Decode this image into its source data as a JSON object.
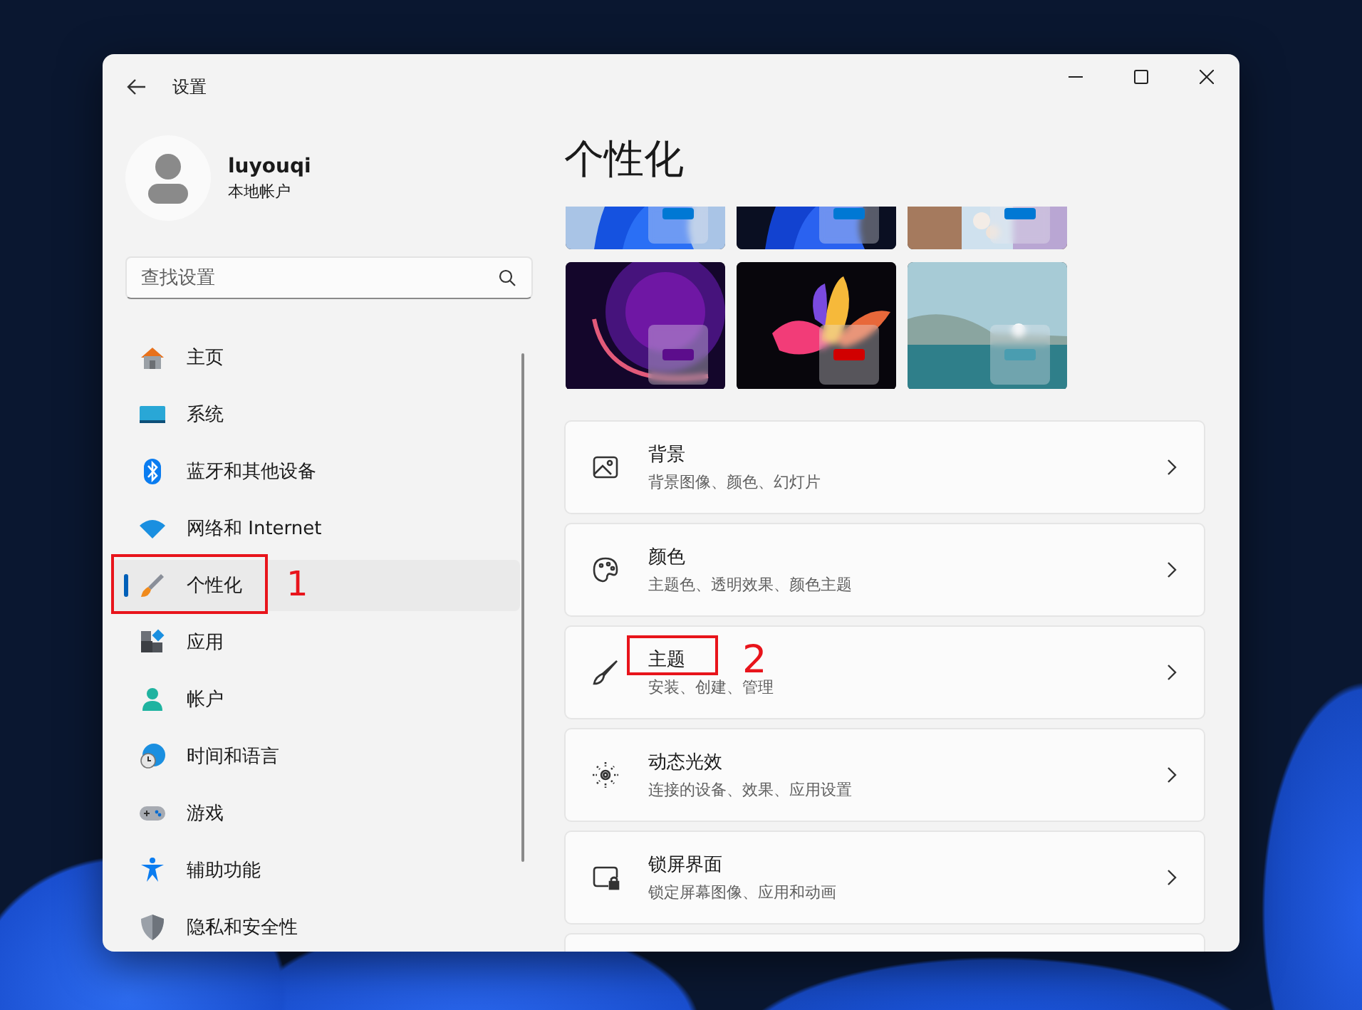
{
  "window": {
    "title": "设置"
  },
  "profile": {
    "name": "luyouqi",
    "account_type": "本地帐户"
  },
  "search": {
    "placeholder": "查找设置"
  },
  "nav": [
    {
      "label": "主页",
      "selected": false
    },
    {
      "label": "系统",
      "selected": false
    },
    {
      "label": "蓝牙和其他设备",
      "selected": false
    },
    {
      "label": "网络和 Internet",
      "selected": false
    },
    {
      "label": "个性化",
      "selected": true,
      "annotation": "1"
    },
    {
      "label": "应用",
      "selected": false
    },
    {
      "label": "帐户",
      "selected": false
    },
    {
      "label": "时间和语言",
      "selected": false
    },
    {
      "label": "游戏",
      "selected": false
    },
    {
      "label": "辅助功能",
      "selected": false
    },
    {
      "label": "隐私和安全性",
      "selected": false
    }
  ],
  "page_title": "个性化",
  "themes": [
    {
      "color": "#0078d4"
    },
    {
      "color": "#0078d4"
    },
    {
      "color": "#0078d4"
    },
    {
      "color": "#5c0d8c"
    },
    {
      "color": "#d10000"
    },
    {
      "color": "#4a9db0"
    }
  ],
  "cards": [
    {
      "title": "背景",
      "subtitle": "背景图像、颜色、幻灯片"
    },
    {
      "title": "颜色",
      "subtitle": "主题色、透明效果、颜色主题"
    },
    {
      "title": "主题",
      "subtitle": "安装、创建、管理",
      "annotation": "2"
    },
    {
      "title": "动态光效",
      "subtitle": "连接的设备、效果、应用设置"
    },
    {
      "title": "锁屏界面",
      "subtitle": "锁定屏幕图像、应用和动画"
    }
  ]
}
